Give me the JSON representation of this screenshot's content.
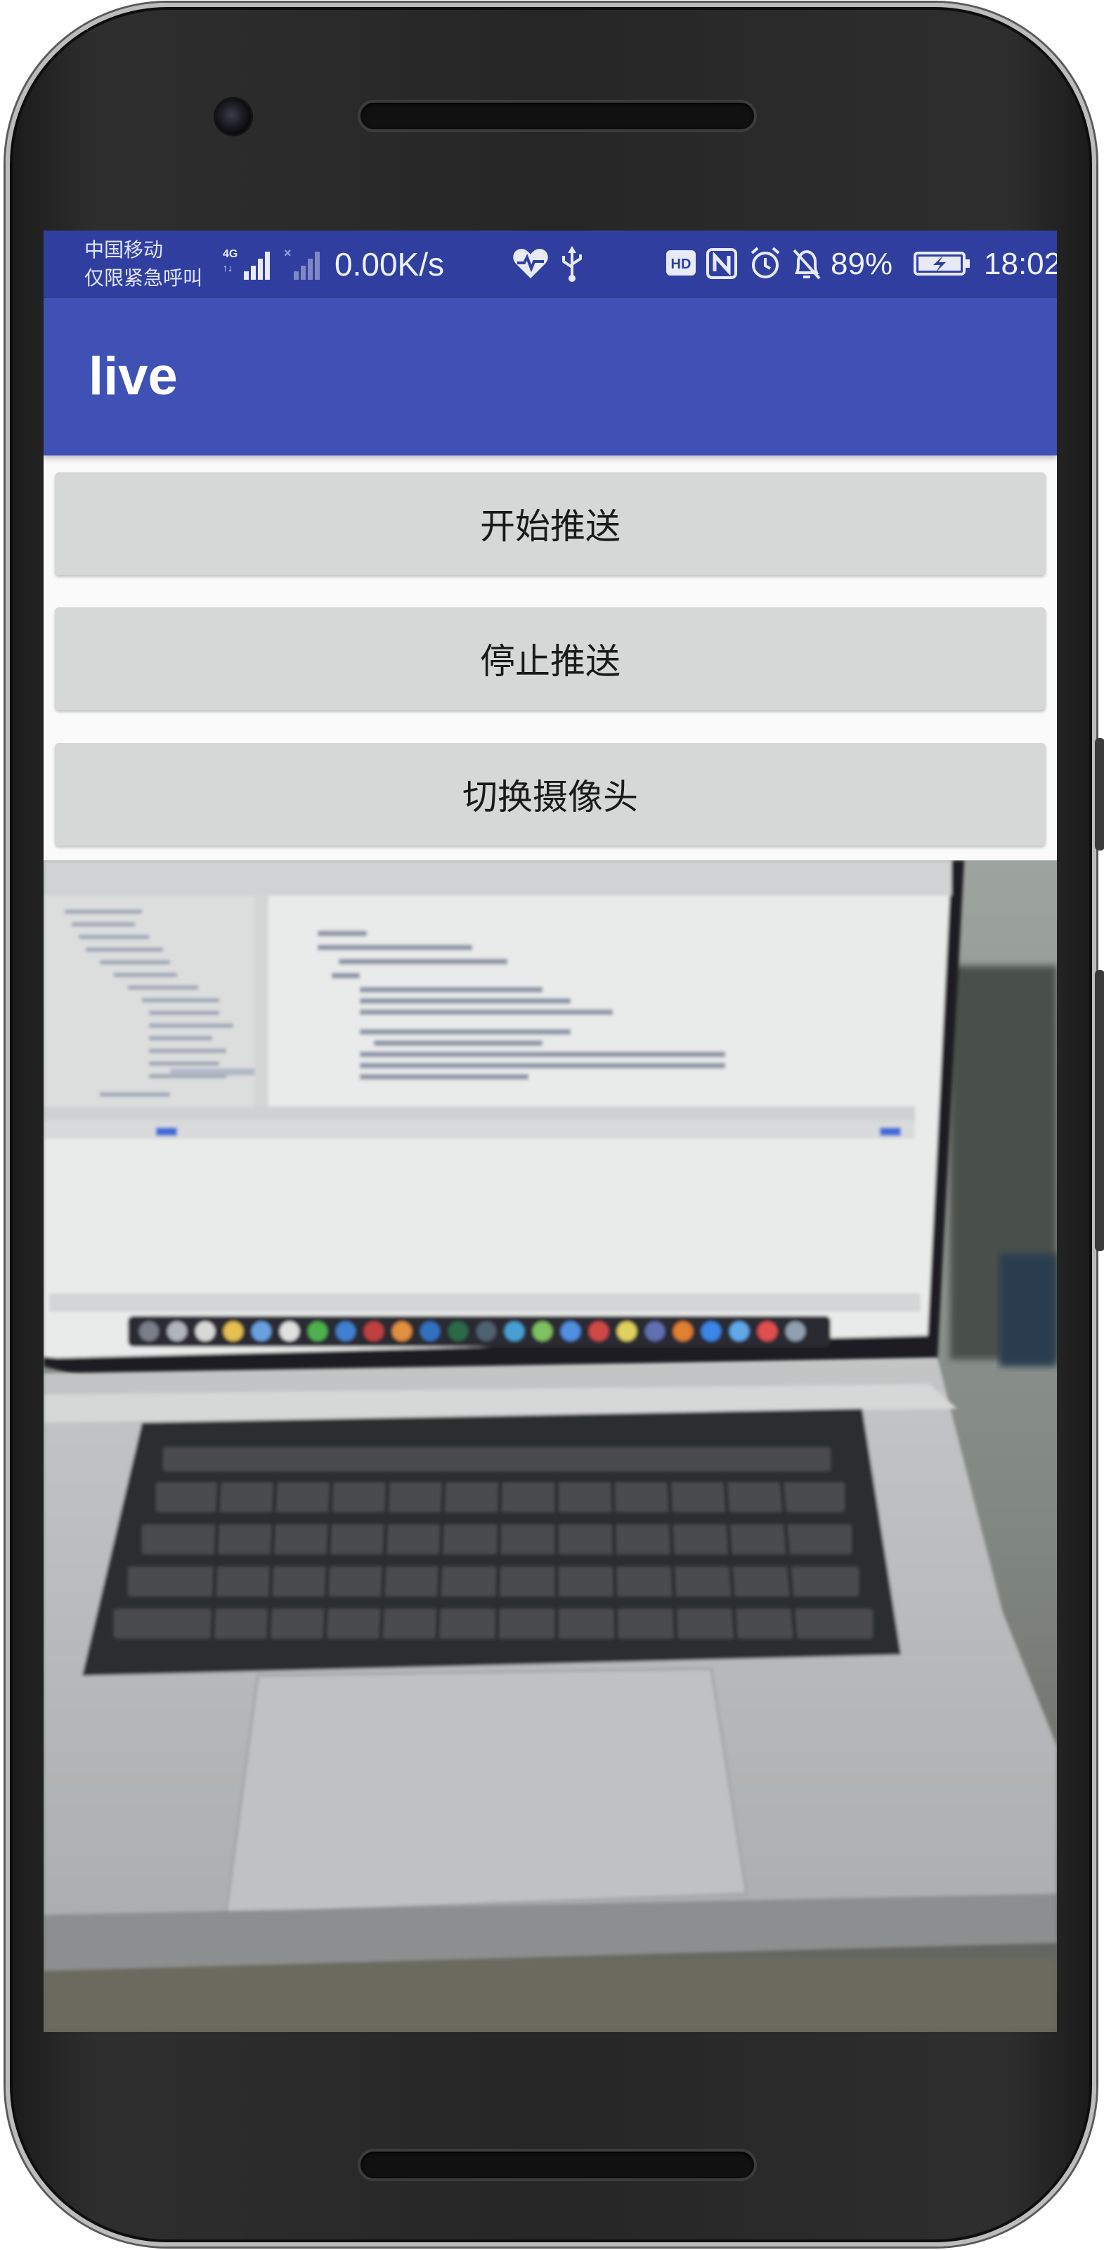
{
  "status_bar": {
    "carrier_line1": "中国移动",
    "carrier_line2": "仅限紧急呼叫",
    "signal_label": "4G",
    "net_speed": "0.00K/s",
    "battery_percent": "89%",
    "time": "18:02",
    "icons": [
      "signal-4g-icon",
      "signal-no-service-icon",
      "heart-rate-icon",
      "usb-icon",
      "hd-icon",
      "nfc-icon",
      "alarm-icon",
      "mute-icon",
      "battery-charging-icon"
    ]
  },
  "app_bar": {
    "title": "live"
  },
  "buttons": {
    "start_push": "开始推送",
    "stop_push": "停止推送",
    "switch_camera": "切换摄像头"
  },
  "colors": {
    "status_bar": "#303f9f",
    "app_bar": "#3f51b5",
    "button": "#d6d7d7"
  }
}
